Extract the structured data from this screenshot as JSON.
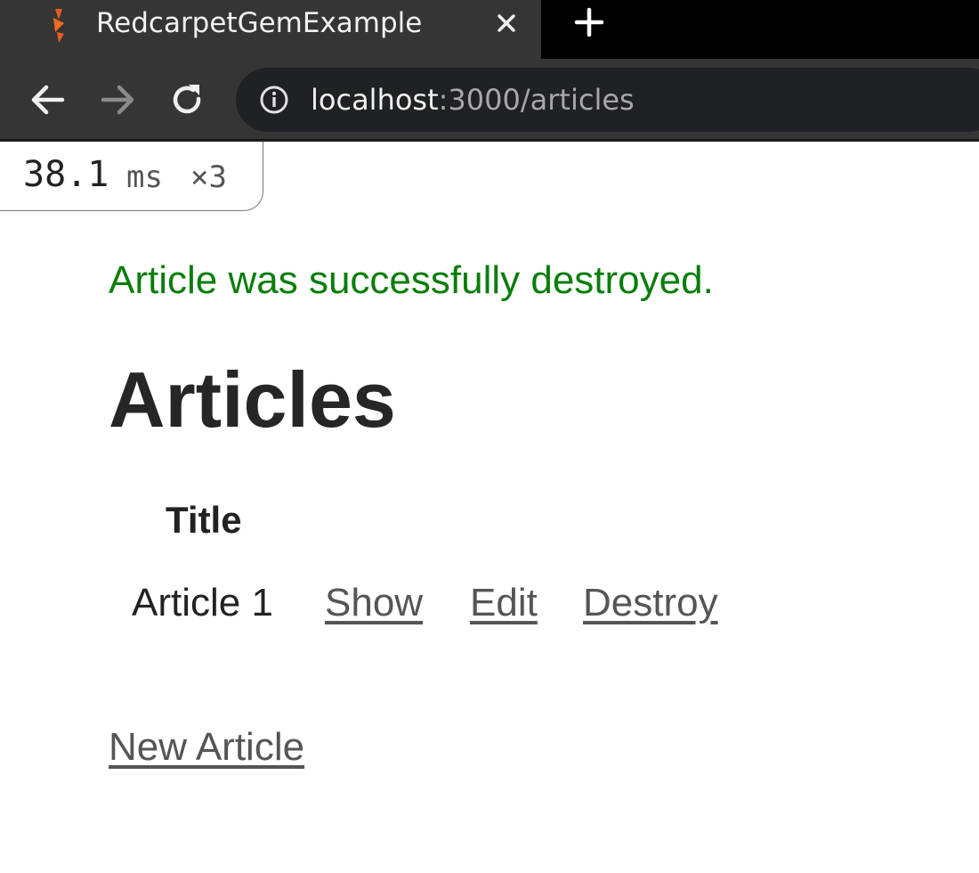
{
  "browser": {
    "tab": {
      "title": "RedcarpetGemExample",
      "favicon": "rails-icon"
    },
    "new_tab_icon": "plus-icon",
    "nav": {
      "back": "arrow-left-icon",
      "forward": "arrow-right-icon",
      "reload": "reload-icon"
    },
    "address": {
      "host": "localhost",
      "path": ":3000/articles",
      "icon": "info-icon"
    }
  },
  "profiler": {
    "time": "38.1",
    "unit": "ms",
    "count": "×3"
  },
  "page": {
    "notice": "Article was successfully destroyed.",
    "title": "Articles",
    "table": {
      "headers": [
        "Title"
      ],
      "rows": [
        {
          "title": "Article 1",
          "show": "Show",
          "edit": "Edit",
          "destroy": "Destroy"
        }
      ]
    },
    "new_link": "New Article"
  },
  "colors": {
    "notice": "#0a7d0a",
    "link": "#555555",
    "chrome": "#353535",
    "tabbar": "#000000"
  }
}
